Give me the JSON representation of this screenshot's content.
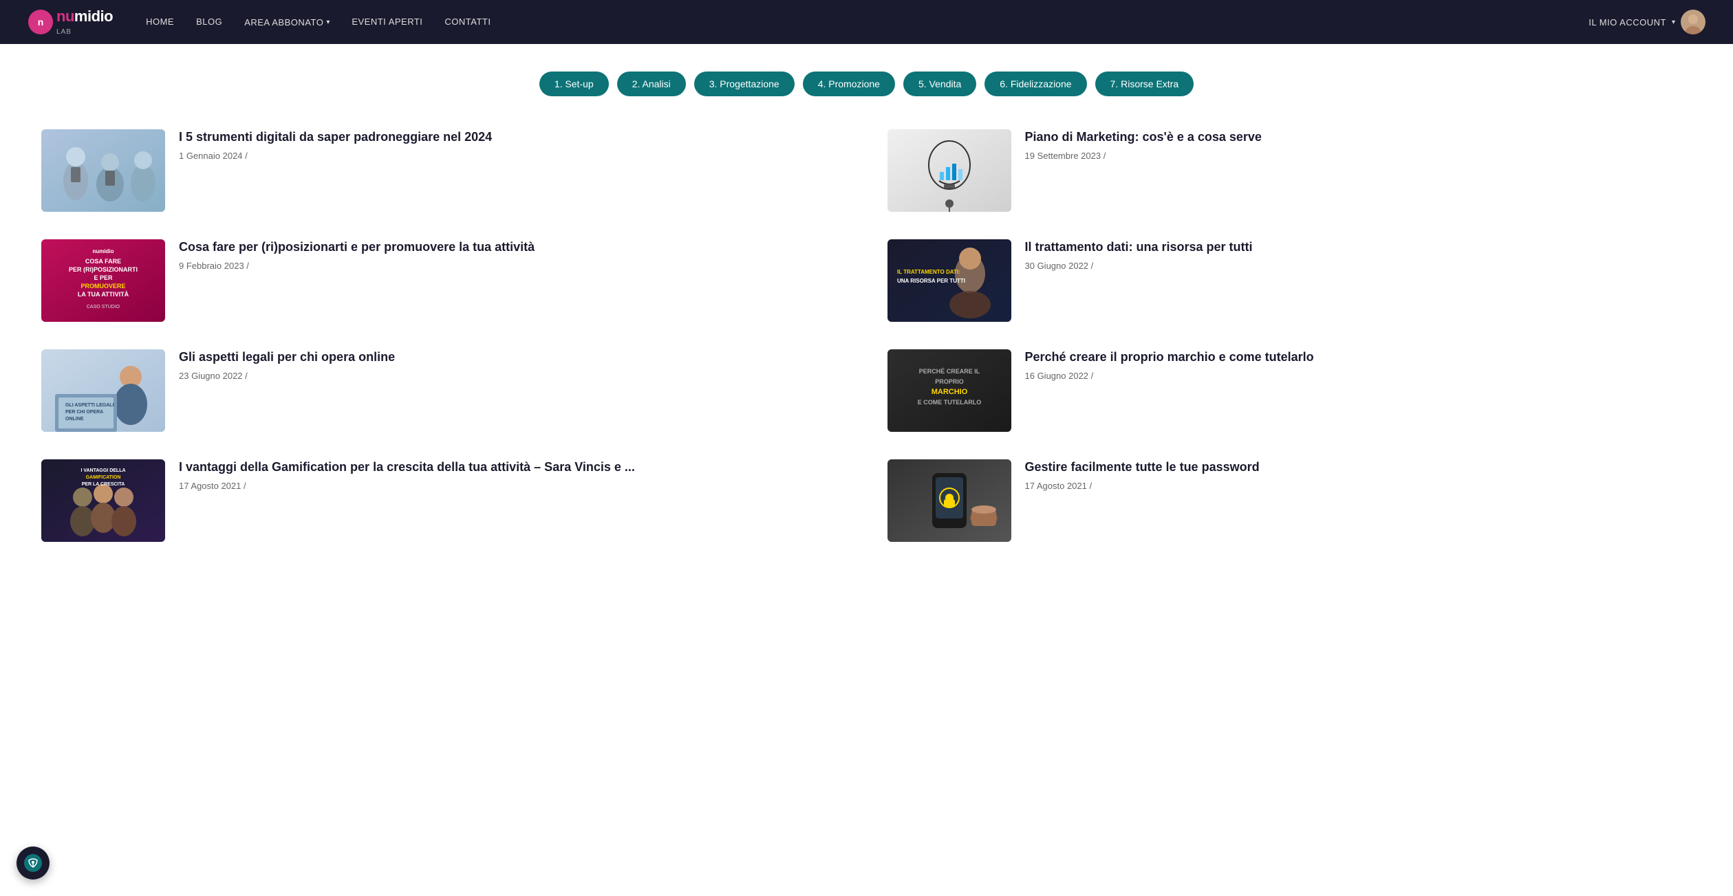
{
  "navbar": {
    "logo_nu": "nu",
    "logo_midio": "midio",
    "logo_lab": "LAB",
    "nav_links": [
      {
        "id": "home",
        "label": "HOME"
      },
      {
        "id": "blog",
        "label": "BLOG"
      },
      {
        "id": "area-abbonato",
        "label": "AREA ABBONATO",
        "has_dropdown": true
      },
      {
        "id": "eventi-aperti",
        "label": "EVENTI APERTI"
      },
      {
        "id": "contatti",
        "label": "CONTATTI"
      }
    ],
    "account_label": "IL MIO ACCOUNT",
    "account_chevron": "▾"
  },
  "tags": [
    {
      "id": "setup",
      "label": "1. Set-up"
    },
    {
      "id": "analisi",
      "label": "2. Analisi"
    },
    {
      "id": "progettazione",
      "label": "3. Progettazione"
    },
    {
      "id": "promozione",
      "label": "4. Promozione"
    },
    {
      "id": "vendita",
      "label": "5. Vendita"
    },
    {
      "id": "fidelizzazione",
      "label": "6. Fidelizzazione"
    },
    {
      "id": "risorse-extra",
      "label": "7. Risorse Extra"
    }
  ],
  "articles": [
    {
      "id": "article-1",
      "title": "I 5 strumenti digitali da saper padroneggiare nel 2024",
      "date": "1 Gennaio 2024 /",
      "thumb_class": "thumb-1",
      "thumb_text": ""
    },
    {
      "id": "article-2",
      "title": "Piano di Marketing: cos'è e a cosa serve",
      "date": "19 Settembre 2023 /",
      "thumb_class": "thumb-2",
      "thumb_text": ""
    },
    {
      "id": "article-3",
      "title": "Cosa fare per (ri)posizionarti e per promuovere la tua attività",
      "date": "9 Febbraio 2023 /",
      "thumb_class": "thumb-3",
      "thumb_text": "COSA FARE PER (RI)POSIZIONARTI E PER PROMUOVERE LA TUA ATTIVITÀ"
    },
    {
      "id": "article-4",
      "title": "Il trattamento dati: una risorsa per tutti",
      "date": "30 Giugno 2022 /",
      "thumb_class": "thumb-4",
      "thumb_text": "IL TRATTAMENTO DATI: UNA RISORSA PER TUTTI"
    },
    {
      "id": "article-5",
      "title": "Gli aspetti legali per chi opera online",
      "date": "23 Giugno 2022 /",
      "thumb_class": "thumb-5",
      "thumb_text": "GLI ASPETTI LEGALI PER CHI OPERA ONLINE"
    },
    {
      "id": "article-6",
      "title": "Perché creare il proprio marchio e come tutelarlo",
      "date": "16 Giugno 2022 /",
      "thumb_class": "thumb-6",
      "thumb_text": "PERCHÉ CREARE IL PROPRIO MARCHIO E COME TUTELARLO"
    },
    {
      "id": "article-7",
      "title": "I vantaggi della Gamification per la crescita della tua attività – Sara Vincis e ...",
      "date": "17 Agosto 2021 /",
      "thumb_class": "thumb-7",
      "thumb_text": "I VANTAGGI DELLA GAMIFICATION PER LA CRESCITA DELLA TUA ATTIVITÀ"
    },
    {
      "id": "article-8",
      "title": "Gestire facilmente tutte le tue password",
      "date": "17 Agosto 2021 /",
      "thumb_class": "thumb-8",
      "thumb_text": ""
    }
  ]
}
